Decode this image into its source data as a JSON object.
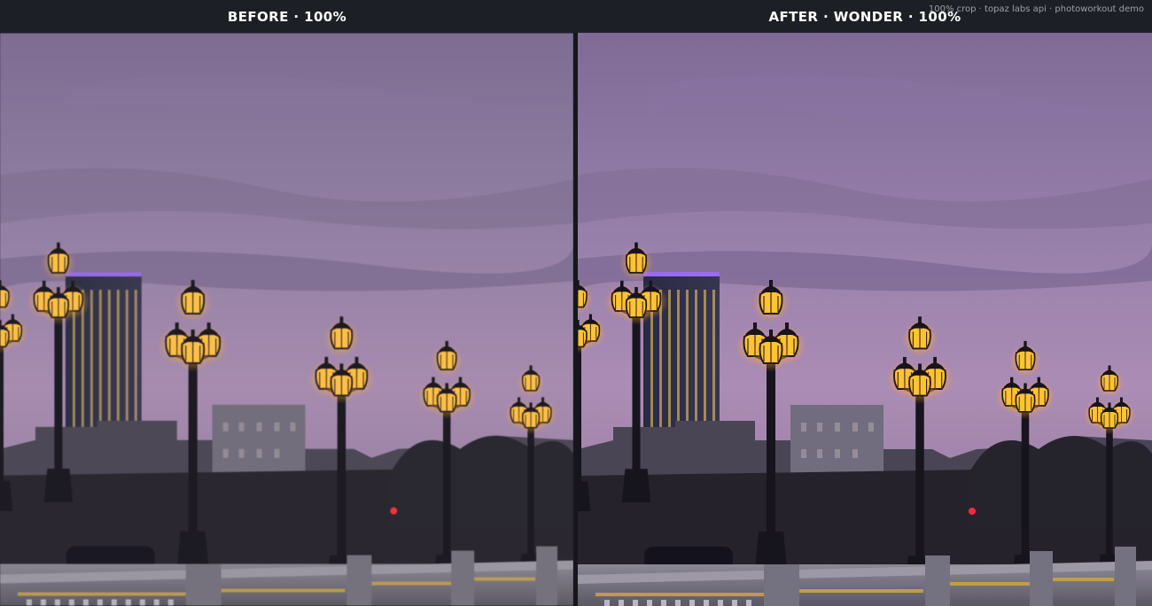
{
  "header": {
    "before_label": "BEFORE · 100%",
    "after_label": "AFTER · WONDER · 100%",
    "watermark": "100% crop · topaz labs api · photoworkout demo"
  },
  "colors": {
    "header_bg": "#1c1f26",
    "sky_top": "#7e6a92",
    "sky_bottom": "#a88aae",
    "lamp_glow": "#ffc44a"
  },
  "panes": [
    {
      "id": "before",
      "description_icon": "photo-icon"
    },
    {
      "id": "after",
      "description_icon": "photo-icon"
    }
  ]
}
